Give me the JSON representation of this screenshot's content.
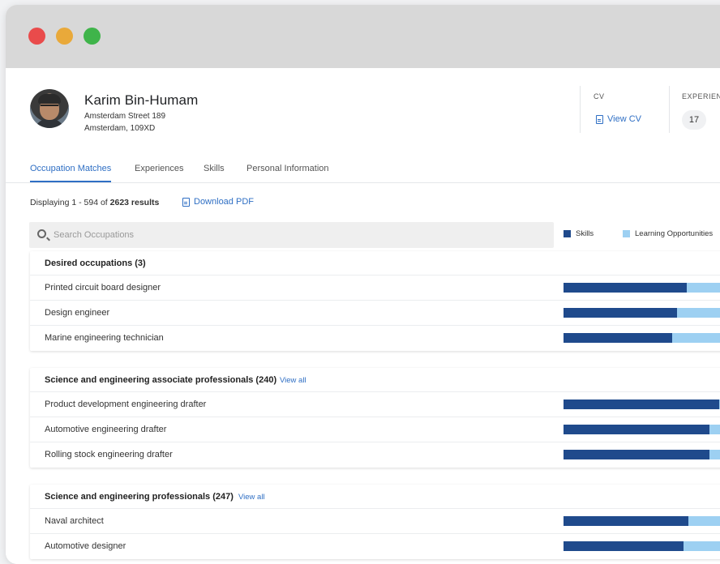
{
  "profile": {
    "name": "Karim Bin-Humam",
    "address_line1": "Amsterdam Street 189",
    "address_line2": "Amsterdam, 109XD"
  },
  "meta": {
    "cv_label": "CV",
    "cv_link": "View CV",
    "experience_label": "EXPERIENC",
    "experience_count": "17"
  },
  "tabs": [
    {
      "label": "Occupation Matches"
    },
    {
      "label": "Experiences"
    },
    {
      "label": "Skills"
    },
    {
      "label": "Personal Information"
    }
  ],
  "results": {
    "prefix": "Displaying 1 - 594 of ",
    "total": "2623 results",
    "download_label": "Download PDF"
  },
  "search": {
    "placeholder": "Search Occupations",
    "value": ""
  },
  "legend": {
    "skills_label": "Skills",
    "learning_label": "Learning Opportunities",
    "skills_color": "#1f4a8c",
    "learning_color": "#9dd0f2"
  },
  "groups": [
    {
      "title": "Desired occupations (3)",
      "view_all": "",
      "rows": [
        {
          "label": "Printed circuit board designer",
          "skills_pct": 0.79
        },
        {
          "label": "Design engineer",
          "skills_pct": 0.73
        },
        {
          "label": "Marine engineering technician",
          "skills_pct": 0.7
        }
      ]
    },
    {
      "title": "Science and engineering associate professionals (240)",
      "view_all": "View all",
      "rows": [
        {
          "label": "Product development engineering drafter",
          "skills_pct": 1.0
        },
        {
          "label": "Automotive engineering drafter",
          "skills_pct": 0.94
        },
        {
          "label": "Rolling stock engineering drafter",
          "skills_pct": 0.94
        }
      ]
    },
    {
      "title": "Science and engineering professionals (247)",
      "view_all": "View all",
      "rows": [
        {
          "label": "Naval architect",
          "skills_pct": 0.8
        },
        {
          "label": "Automotive designer",
          "skills_pct": 0.77
        }
      ]
    }
  ]
}
